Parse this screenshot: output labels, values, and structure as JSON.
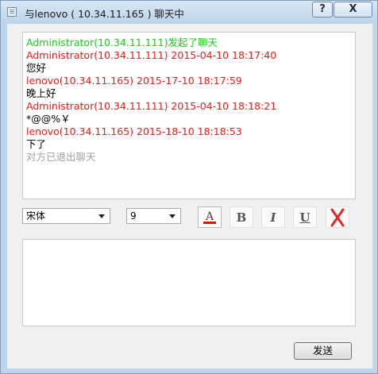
{
  "window": {
    "title": "与lenovo ( 10.34.11.165 ) 聊天中"
  },
  "title_buttons": {
    "help": "?",
    "close": "X"
  },
  "messages": [
    {
      "text": "Administrator(10.34.11.111)发起了聊天",
      "color": "#1ec81e"
    },
    {
      "text": "Administrator(10.34.11.111) 2015-04-10 18:17:40",
      "color": "#e0201e"
    },
    {
      "text": "您好",
      "color": "#000000"
    },
    {
      "text": "lenovo(10.34.11.165) 2015-17-10 18:17:59",
      "color": "#e0201e"
    },
    {
      "text": "晚上好",
      "color": "#000000"
    },
    {
      "text": "Administrator(10.34.11.111) 2015-04-10 18:18:21",
      "color": "#e0201e"
    },
    {
      "text": "*@@%￥",
      "color": "#000000"
    },
    {
      "text": "lenovo(10.34.11.165) 2015-18-10 18:18:53",
      "color": "#e0201e"
    },
    {
      "text": "下了",
      "color": "#000000"
    },
    {
      "text": "对方已退出聊天",
      "color": "#a0a0a0"
    }
  ],
  "toolbar": {
    "font_value": "宋体",
    "size_value": "9",
    "color_label": "A",
    "bold_label": "B",
    "italic_label": "I",
    "underline_label": "U",
    "color_indicator": "#ff0000"
  },
  "input": {
    "value": ""
  },
  "send_label": "发送"
}
